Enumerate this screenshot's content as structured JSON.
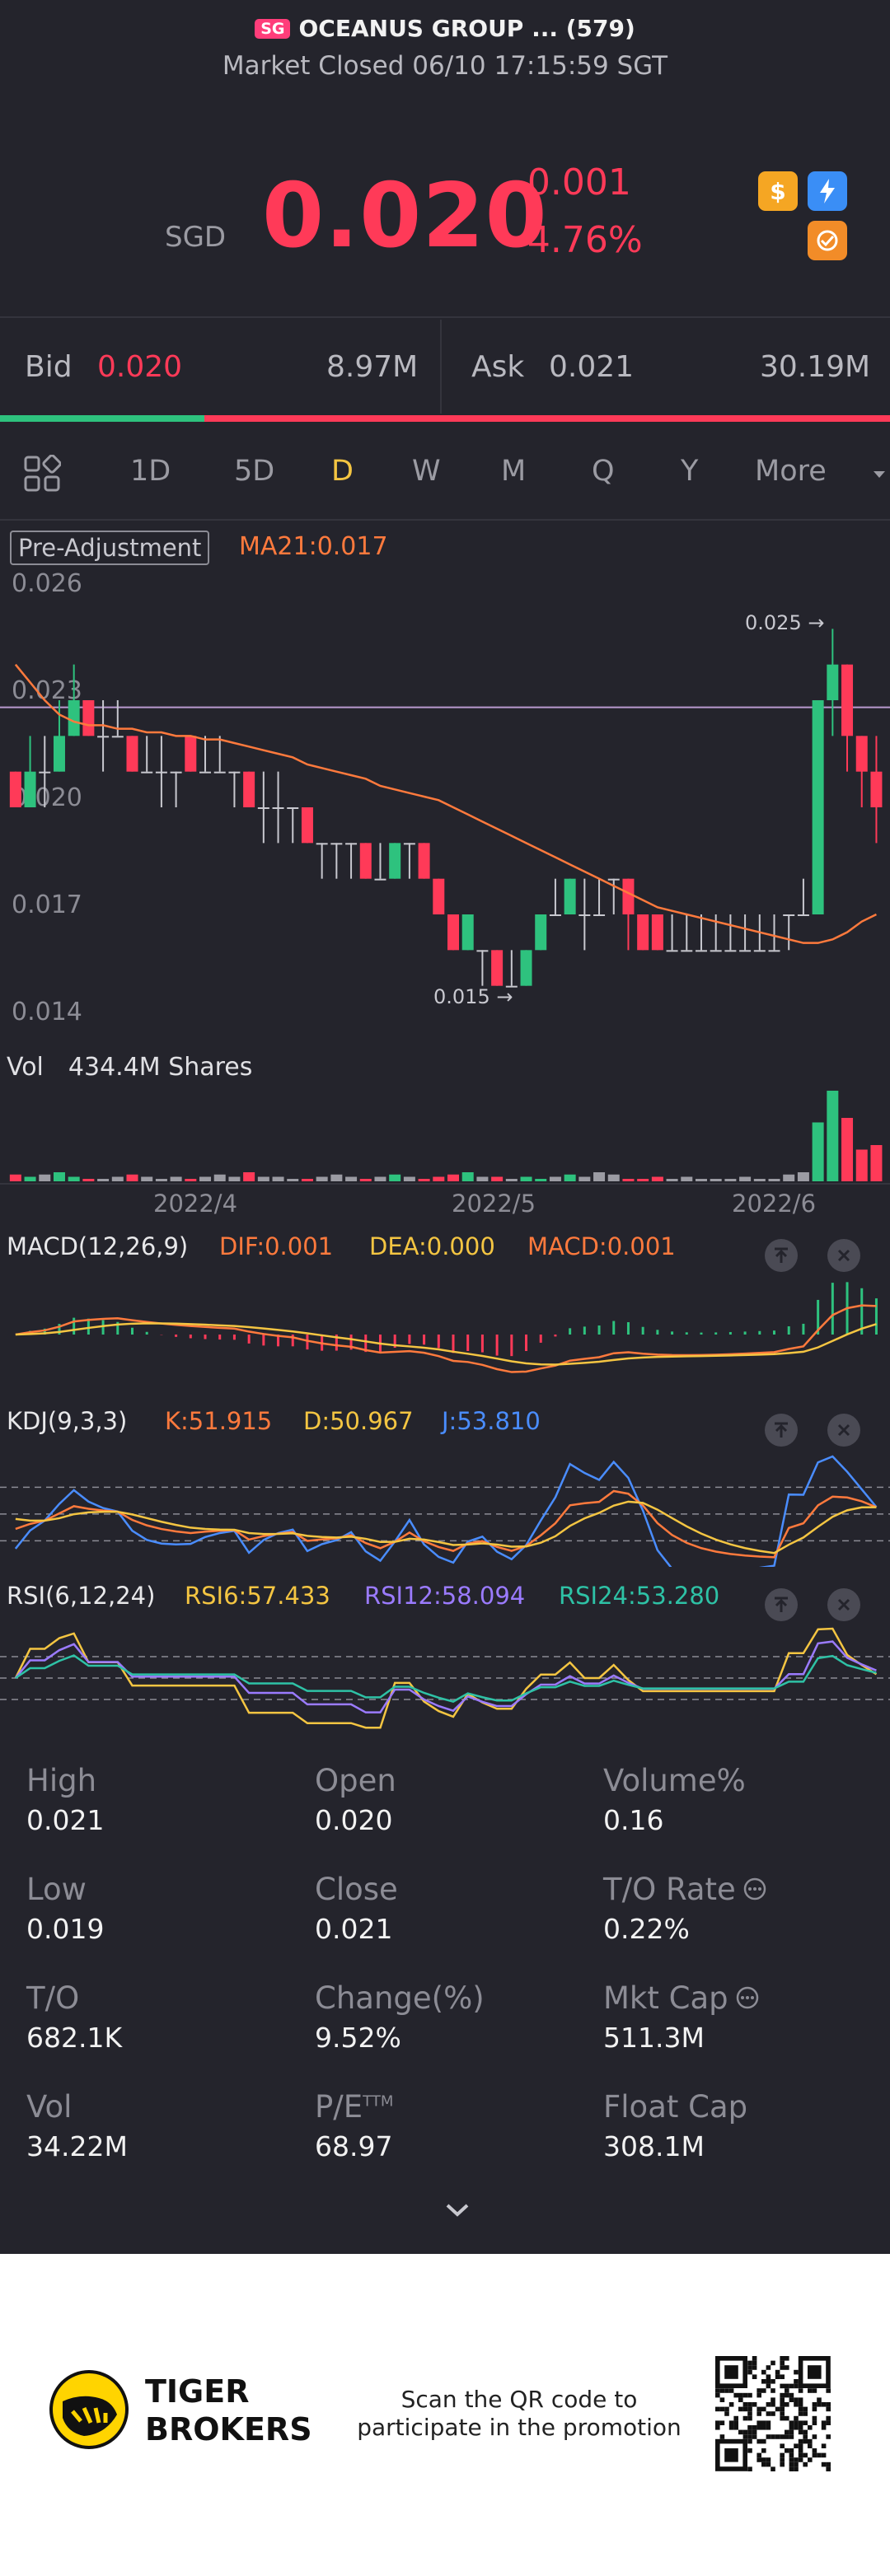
{
  "header": {
    "market_badge": "SG",
    "title": "OCEANUS GROUP ... (579)",
    "status": "Market Closed 06/10 17:15:59 SGT"
  },
  "quote": {
    "currency": "SGD",
    "price": "0.020",
    "change": "-0.001",
    "change_pct": "-4.76%",
    "colors": {
      "down": "#ff3a58",
      "up": "#2ec27e"
    }
  },
  "orderbook": {
    "bid_label": "Bid",
    "bid_price": "0.020",
    "bid_size": "8.97M",
    "ask_label": "Ask",
    "ask_price": "0.021",
    "ask_size": "30.19M",
    "bid_fraction": 0.23
  },
  "tabs": {
    "items": [
      "1D",
      "5D",
      "D",
      "W",
      "M",
      "Q",
      "Y"
    ],
    "active": "D",
    "more": "More"
  },
  "main_chart": {
    "adjust_label": "Pre-Adjustment",
    "ma_label": "MA21:0.017",
    "y_ticks": [
      "0.026",
      "0.023",
      "0.020",
      "0.017",
      "0.014"
    ],
    "max_label": "0.025",
    "min_label": "0.015",
    "vol_label": "Vol",
    "vol_value": "434.4M Shares",
    "x_ticks": [
      "2022/4",
      "2022/5",
      "2022/6"
    ]
  },
  "macd": {
    "title": "MACD(12,26,9)",
    "dif": "DIF:0.001",
    "dea": "DEA:0.000",
    "macd": "MACD:0.001"
  },
  "kdj": {
    "title": "KDJ(9,3,3)",
    "k": "K:51.915",
    "d": "D:50.967",
    "j": "J:53.810"
  },
  "rsi": {
    "title": "RSI(6,12,24)",
    "rsi6": "RSI6:57.433",
    "rsi12": "RSI12:58.094",
    "rsi24": "RSI24:53.280"
  },
  "stats": [
    {
      "label": "High",
      "value": "0.021"
    },
    {
      "label": "Open",
      "value": "0.020"
    },
    {
      "label": "Volume%",
      "value": "0.16"
    },
    {
      "label": "Low",
      "value": "0.019"
    },
    {
      "label": "Close",
      "value": "0.021"
    },
    {
      "label": "T/O Rate",
      "value": "0.22%"
    },
    {
      "label": "T/O",
      "value": "682.1K"
    },
    {
      "label": "Change(%)",
      "value": "9.52%"
    },
    {
      "label": "Mkt Cap",
      "value": "511.3M"
    },
    {
      "label": "Vol",
      "value": "34.22M"
    },
    {
      "label": "P/E",
      "value": "68.97",
      "sup": "TTM"
    },
    {
      "label": "Float Cap",
      "value": "308.1M"
    }
  ],
  "footer": {
    "brand_line1": "TIGER",
    "brand_line2": "BROKERS",
    "promo_line1": "Scan the QR code to",
    "promo_line2": "participate in the promotion"
  },
  "chart_data": {
    "type": "candlestick",
    "ylim": [
      0.014,
      0.026
    ],
    "ma21_last": 0.017,
    "candles": [
      [
        0.021,
        0.02,
        0.021,
        0.02
      ],
      [
        0.02,
        0.021,
        0.022,
        0.02
      ],
      [
        0.021,
        0.021,
        0.022,
        0.02
      ],
      [
        0.021,
        0.022,
        0.023,
        0.021
      ],
      [
        0.022,
        0.023,
        0.024,
        0.022
      ],
      [
        0.023,
        0.022,
        0.023,
        0.022
      ],
      [
        0.022,
        0.022,
        0.023,
        0.021
      ],
      [
        0.022,
        0.022,
        0.023,
        0.022
      ],
      [
        0.022,
        0.021,
        0.022,
        0.021
      ],
      [
        0.021,
        0.021,
        0.022,
        0.021
      ],
      [
        0.021,
        0.021,
        0.022,
        0.02
      ],
      [
        0.021,
        0.021,
        0.021,
        0.02
      ],
      [
        0.022,
        0.021,
        0.022,
        0.021
      ],
      [
        0.021,
        0.021,
        0.022,
        0.021
      ],
      [
        0.021,
        0.021,
        0.022,
        0.021
      ],
      [
        0.021,
        0.021,
        0.021,
        0.02
      ],
      [
        0.021,
        0.02,
        0.021,
        0.02
      ],
      [
        0.02,
        0.02,
        0.021,
        0.019
      ],
      [
        0.02,
        0.02,
        0.021,
        0.019
      ],
      [
        0.02,
        0.02,
        0.02,
        0.019
      ],
      [
        0.02,
        0.019,
        0.02,
        0.019
      ],
      [
        0.019,
        0.019,
        0.019,
        0.018
      ],
      [
        0.019,
        0.019,
        0.019,
        0.018
      ],
      [
        0.019,
        0.019,
        0.019,
        0.018
      ],
      [
        0.019,
        0.018,
        0.019,
        0.018
      ],
      [
        0.018,
        0.018,
        0.019,
        0.018
      ],
      [
        0.018,
        0.019,
        0.019,
        0.018
      ],
      [
        0.019,
        0.019,
        0.019,
        0.018
      ],
      [
        0.019,
        0.018,
        0.019,
        0.018
      ],
      [
        0.018,
        0.017,
        0.018,
        0.017
      ],
      [
        0.017,
        0.016,
        0.017,
        0.016
      ],
      [
        0.016,
        0.017,
        0.017,
        0.016
      ],
      [
        0.016,
        0.016,
        0.016,
        0.015
      ],
      [
        0.016,
        0.015,
        0.016,
        0.015
      ],
      [
        0.015,
        0.015,
        0.016,
        0.015
      ],
      [
        0.015,
        0.016,
        0.016,
        0.015
      ],
      [
        0.016,
        0.017,
        0.017,
        0.016
      ],
      [
        0.017,
        0.017,
        0.018,
        0.017
      ],
      [
        0.017,
        0.018,
        0.018,
        0.017
      ],
      [
        0.017,
        0.017,
        0.018,
        0.016
      ],
      [
        0.017,
        0.017,
        0.018,
        0.017
      ],
      [
        0.018,
        0.018,
        0.018,
        0.017
      ],
      [
        0.018,
        0.017,
        0.018,
        0.016
      ],
      [
        0.017,
        0.016,
        0.017,
        0.016
      ],
      [
        0.017,
        0.016,
        0.017,
        0.016
      ],
      [
        0.016,
        0.016,
        0.017,
        0.016
      ],
      [
        0.016,
        0.016,
        0.017,
        0.016
      ],
      [
        0.016,
        0.016,
        0.017,
        0.016
      ],
      [
        0.016,
        0.016,
        0.017,
        0.016
      ],
      [
        0.016,
        0.016,
        0.017,
        0.016
      ],
      [
        0.016,
        0.016,
        0.017,
        0.016
      ],
      [
        0.016,
        0.016,
        0.017,
        0.016
      ],
      [
        0.016,
        0.016,
        0.017,
        0.016
      ],
      [
        0.017,
        0.017,
        0.017,
        0.016
      ],
      [
        0.017,
        0.017,
        0.018,
        0.017
      ],
      [
        0.017,
        0.023,
        0.023,
        0.017
      ],
      [
        0.023,
        0.024,
        0.025,
        0.022
      ],
      [
        0.024,
        0.022,
        0.024,
        0.021
      ],
      [
        0.022,
        0.021,
        0.022,
        0.02
      ],
      [
        0.021,
        0.02,
        0.022,
        0.019
      ]
    ],
    "volume": [
      3,
      2,
      3,
      4,
      2,
      1,
      1,
      2,
      3,
      2,
      1,
      2,
      1,
      2,
      3,
      2,
      4,
      2,
      2,
      1,
      1,
      2,
      3,
      2,
      1,
      2,
      3,
      2,
      1,
      2,
      3,
      4,
      2,
      2,
      1,
      2,
      1,
      2,
      3,
      2,
      4,
      3,
      1,
      1,
      2,
      1,
      2,
      1,
      1,
      1,
      2,
      1,
      1,
      3,
      4,
      26,
      40,
      28,
      14,
      16
    ],
    "ma21": [
      0.024,
      0.0235,
      0.023,
      0.0226,
      0.0224,
      0.0223,
      0.0223,
      0.0222,
      0.0222,
      0.0221,
      0.0221,
      0.022,
      0.022,
      0.0219,
      0.0219,
      0.0218,
      0.0217,
      0.0216,
      0.0215,
      0.0214,
      0.0212,
      0.0211,
      0.021,
      0.0209,
      0.0208,
      0.0206,
      0.0205,
      0.0204,
      0.0203,
      0.0202,
      0.02,
      0.0198,
      0.0196,
      0.0194,
      0.0192,
      0.019,
      0.0188,
      0.0186,
      0.0184,
      0.0182,
      0.018,
      0.0178,
      0.0176,
      0.0174,
      0.0172,
      0.0171,
      0.017,
      0.0169,
      0.0168,
      0.0167,
      0.0166,
      0.0165,
      0.0164,
      0.0163,
      0.0162,
      0.0162,
      0.0163,
      0.0165,
      0.0168,
      0.017
    ]
  }
}
